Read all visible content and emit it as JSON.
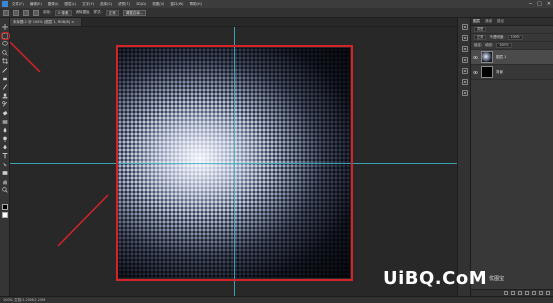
{
  "menubar": {
    "items": [
      "文件(F)",
      "编辑(E)",
      "图像(I)",
      "图层(L)",
      "文字(Y)",
      "选择(S)",
      "滤镜(T)",
      "3D(D)",
      "视图(V)",
      "窗口(W)",
      "帮助(H)"
    ],
    "window_controls": [
      "─",
      "□",
      "✕"
    ]
  },
  "optionsbar": {
    "feather_label": "羽化:",
    "feather_value": "0 像素",
    "antialias_label": "消除锯齿",
    "style_label": "样式:",
    "style_value": "正常",
    "refine_button": "调整边缘..."
  },
  "document_tab": {
    "title": "未标题-1 @ 100% (图层 1, RGB/8) ×"
  },
  "statusbar": {
    "text": "100%    文档:2.25M/2.25M"
  },
  "layers_panel": {
    "tabs": [
      "图层",
      "通道",
      "路径"
    ],
    "filter_label": "类型",
    "blend_mode": "正常",
    "opacity_label": "不透明度:",
    "opacity_value": "100%",
    "lock_label": "锁定:",
    "fill_label": "填充:",
    "fill_value": "100%",
    "layers": [
      {
        "name": "图层 1",
        "selected": true
      },
      {
        "name": "背景",
        "selected": false
      }
    ]
  },
  "tools": [
    "move-tool-icon",
    "marquee-tool-icon",
    "lasso-tool-icon",
    "quick-select-tool-icon",
    "crop-tool-icon",
    "eyedropper-tool-icon",
    "healing-brush-tool-icon",
    "brush-tool-icon",
    "clone-stamp-tool-icon",
    "history-brush-tool-icon",
    "eraser-tool-icon",
    "gradient-tool-icon",
    "blur-tool-icon",
    "dodge-tool-icon",
    "pen-tool-icon",
    "type-tool-icon",
    "path-select-tool-icon",
    "shape-tool-icon",
    "hand-tool-icon",
    "zoom-tool-icon"
  ],
  "watermark": {
    "brand": "UiBQ.CoM",
    "sub": "优图宝"
  },
  "colors": {
    "highlight_red": "#d5232a",
    "guide_cyan": "#3fb6c5",
    "ps_blue": "#3a87d8"
  }
}
